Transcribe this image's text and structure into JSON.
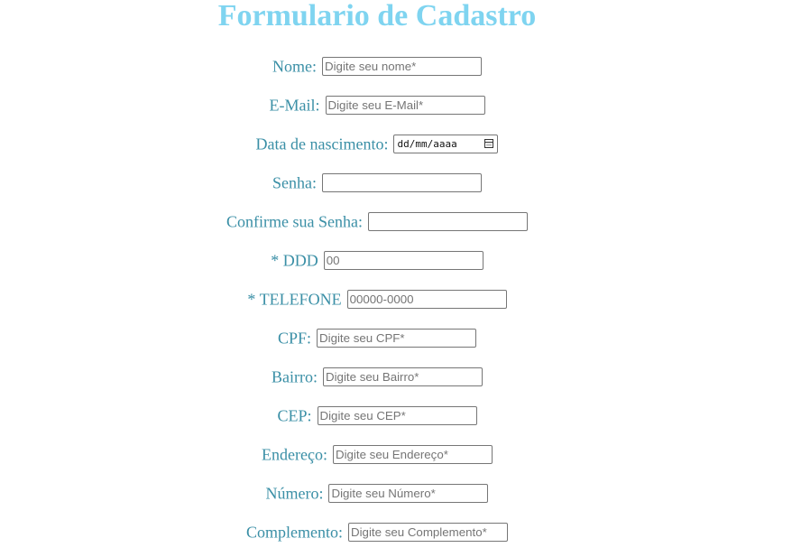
{
  "page": {
    "title": "Formulario de Cadastro"
  },
  "form": {
    "fields": [
      {
        "key": "nome",
        "label": "Nome:",
        "placeholder": "Digite seu nome*",
        "value": ""
      },
      {
        "key": "email",
        "label": "E-Mail:",
        "placeholder": "Digite seu E-Mail*",
        "value": ""
      },
      {
        "key": "nascimento",
        "label": "Data de nascimento:",
        "placeholder": "dd/mm/aaaa",
        "value": ""
      },
      {
        "key": "senha",
        "label": "Senha:",
        "placeholder": "",
        "value": ""
      },
      {
        "key": "confirme_senha",
        "label": "Confirme sua Senha:",
        "placeholder": "",
        "value": ""
      },
      {
        "key": "ddd",
        "label": "* DDD",
        "placeholder": "00",
        "value": ""
      },
      {
        "key": "telefone",
        "label": "* TELEFONE",
        "placeholder": "00000-0000",
        "value": ""
      },
      {
        "key": "cpf",
        "label": "CPF:",
        "placeholder": "Digite seu CPF*",
        "value": ""
      },
      {
        "key": "bairro",
        "label": "Bairro:",
        "placeholder": "Digite seu Bairro*",
        "value": ""
      },
      {
        "key": "cep",
        "label": "CEP:",
        "placeholder": "Digite seu CEP*",
        "value": ""
      },
      {
        "key": "endereco",
        "label": "Endereço:",
        "placeholder": "Digite seu Endereço*",
        "value": ""
      },
      {
        "key": "numero",
        "label": "Número:",
        "placeholder": "Digite seu Número*",
        "value": ""
      },
      {
        "key": "complemento",
        "label": "Complemento:",
        "placeholder": "Digite seu Complemento*",
        "value": ""
      }
    ],
    "date_icon": "calendar-icon"
  },
  "colors": {
    "title": "#7fd4f0",
    "label": "#3a8fa6"
  }
}
